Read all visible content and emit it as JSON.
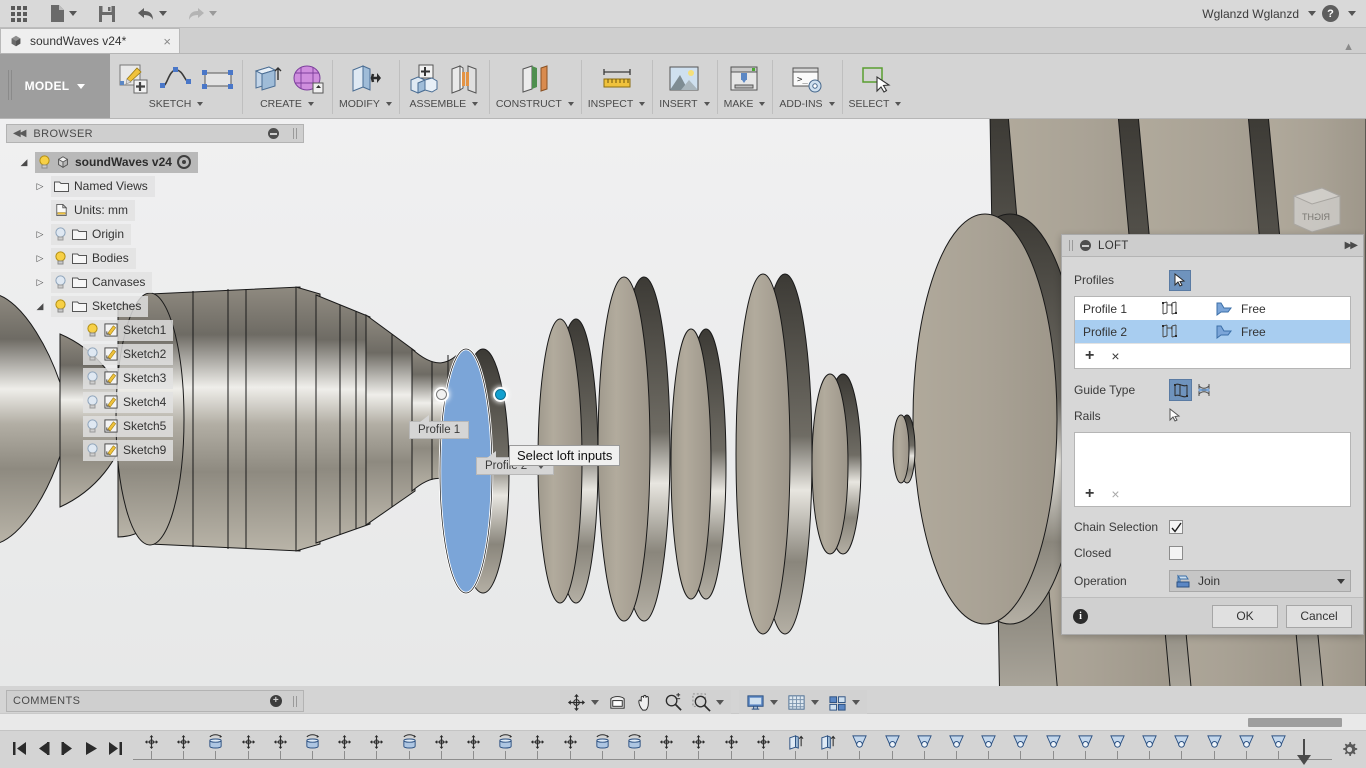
{
  "app": {
    "user": "Wglanzd Wglanzd",
    "help_label": "?"
  },
  "topbar": {
    "items": [
      {
        "name": "app-grid",
        "icon": "grid-icon",
        "caret": false
      },
      {
        "name": "new-file",
        "icon": "file-icon",
        "caret": true
      },
      {
        "name": "save",
        "icon": "save-icon",
        "caret": false
      },
      {
        "name": "undo",
        "icon": "undo-icon",
        "caret": true
      },
      {
        "name": "redo",
        "icon": "redo-icon",
        "caret": true
      }
    ]
  },
  "tab": {
    "title": "soundWaves v24*",
    "close": "×",
    "icon": "cube-icon"
  },
  "ribbon": {
    "mode": "MODEL",
    "groups": [
      {
        "label": "SKETCH",
        "icons": [
          "create-sketch-icon",
          "spline-icon",
          "rectangle-icon"
        ]
      },
      {
        "label": "CREATE",
        "icons": [
          "extrude-icon",
          "create-form-icon"
        ]
      },
      {
        "label": "MODIFY",
        "icons": [
          "press-pull-icon"
        ]
      },
      {
        "label": "ASSEMBLE",
        "icons": [
          "new-component-icon",
          "joint-icon"
        ]
      },
      {
        "label": "CONSTRUCT",
        "icons": [
          "offset-plane-icon"
        ]
      },
      {
        "label": "INSPECT",
        "icons": [
          "measure-icon"
        ]
      },
      {
        "label": "INSERT",
        "icons": [
          "insert-image-icon"
        ]
      },
      {
        "label": "MAKE",
        "icons": [
          "3d-print-icon"
        ]
      },
      {
        "label": "ADD-INS",
        "icons": [
          "scripts-addins-icon"
        ]
      },
      {
        "label": "SELECT",
        "icons": [
          "select-window-icon"
        ]
      }
    ]
  },
  "browser": {
    "header": "BROWSER",
    "root": {
      "label": "soundWaves v24",
      "icon": "cube-icon"
    },
    "items": [
      {
        "label": "Named Views",
        "twisty": "collapsed",
        "bulb": "none",
        "icon": "folder-icon",
        "indent": 1
      },
      {
        "label": "Units: mm",
        "twisty": "none",
        "bulb": "none",
        "icon": "document-icon",
        "indent": 1
      },
      {
        "label": "Origin",
        "twisty": "collapsed",
        "bulb": "off",
        "icon": "folder-icon",
        "indent": 1
      },
      {
        "label": "Bodies",
        "twisty": "collapsed",
        "bulb": "on",
        "icon": "folder-icon",
        "indent": 1
      },
      {
        "label": "Canvases",
        "twisty": "collapsed",
        "bulb": "off",
        "icon": "folder-icon",
        "indent": 1
      },
      {
        "label": "Sketches",
        "twisty": "expanded",
        "bulb": "on",
        "icon": "folder-icon",
        "indent": 1
      },
      {
        "label": "Sketch1",
        "twisty": "none",
        "bulb": "on",
        "icon": "sketch-icon",
        "indent": 2
      },
      {
        "label": "Sketch2",
        "twisty": "none",
        "bulb": "off",
        "icon": "sketch-icon",
        "indent": 2
      },
      {
        "label": "Sketch3",
        "twisty": "none",
        "bulb": "off",
        "icon": "sketch-icon",
        "indent": 2
      },
      {
        "label": "Sketch4",
        "twisty": "none",
        "bulb": "off",
        "icon": "sketch-icon",
        "indent": 2
      },
      {
        "label": "Sketch5",
        "twisty": "none",
        "bulb": "off",
        "icon": "sketch-icon",
        "indent": 2
      },
      {
        "label": "Sketch9",
        "twisty": "none",
        "bulb": "off",
        "icon": "sketch-icon",
        "indent": 2
      }
    ]
  },
  "viewport": {
    "profile1_label": "Profile 1",
    "profile2_label": "Profile 2",
    "tooltip": "Select loft inputs",
    "viewcube_face": "RIGHT"
  },
  "loft": {
    "title": "LOFT",
    "profiles_label": "Profiles",
    "select_icon": "cursor-arrow-icon",
    "rows": [
      {
        "name": "Profile 1",
        "continuity": "Free",
        "selected": false
      },
      {
        "name": "Profile 2",
        "continuity": "Free",
        "selected": true
      }
    ],
    "add_label": "+",
    "remove_label": "×",
    "guide_type_label": "Guide Type",
    "guide_type_options": [
      "rails-icon",
      "centerline-icon"
    ],
    "guide_type_selected": 0,
    "rails_label": "Rails",
    "chain_selection_label": "Chain Selection",
    "chain_selection_checked": true,
    "closed_label": "Closed",
    "closed_checked": false,
    "operation_label": "Operation",
    "operation_value": "Join",
    "ok_label": "OK",
    "cancel_label": "Cancel",
    "accent_color": "#6f93bd",
    "row_select_color": "#a8cdf0"
  },
  "navbar": {
    "groups": [
      {
        "items": [
          {
            "name": "orbit-icon",
            "caret": true
          },
          {
            "name": "look-at-icon",
            "caret": false
          },
          {
            "name": "pan-icon",
            "caret": false
          },
          {
            "name": "zoom-icon",
            "caret": false
          },
          {
            "name": "zoom-window-icon",
            "caret": true
          }
        ]
      },
      {
        "items": [
          {
            "name": "display-settings-icon",
            "caret": true
          },
          {
            "name": "grid-snaps-icon",
            "caret": true
          },
          {
            "name": "viewports-icon",
            "caret": true
          }
        ]
      }
    ]
  },
  "comments": {
    "label": "COMMENTS",
    "add": "+"
  },
  "timeline": {
    "playback": [
      "skip-start-icon",
      "step-back-icon",
      "step-forward-icon",
      "play-icon",
      "skip-end-icon"
    ],
    "settings_icon": "gear-icon",
    "features": [
      "sketch-icon",
      "sketch-icon",
      "revolve-icon",
      "sketch-icon",
      "sketch-icon",
      "revolve-icon",
      "sketch-icon",
      "sketch-icon",
      "revolve-icon",
      "sketch-icon",
      "sketch-icon",
      "revolve-icon",
      "sketch-icon",
      "sketch-icon",
      "revolve-icon",
      "revolve-icon",
      "sketch-icon",
      "sketch-icon",
      "sketch-icon",
      "sketch-icon",
      "extrude-icon",
      "extrude-icon",
      "loft-icon",
      "loft-icon",
      "loft-icon",
      "loft-icon",
      "loft-icon",
      "loft-icon",
      "loft-icon",
      "loft-icon",
      "loft-icon",
      "loft-icon",
      "loft-icon",
      "loft-icon",
      "loft-icon",
      "loft-icon"
    ]
  }
}
